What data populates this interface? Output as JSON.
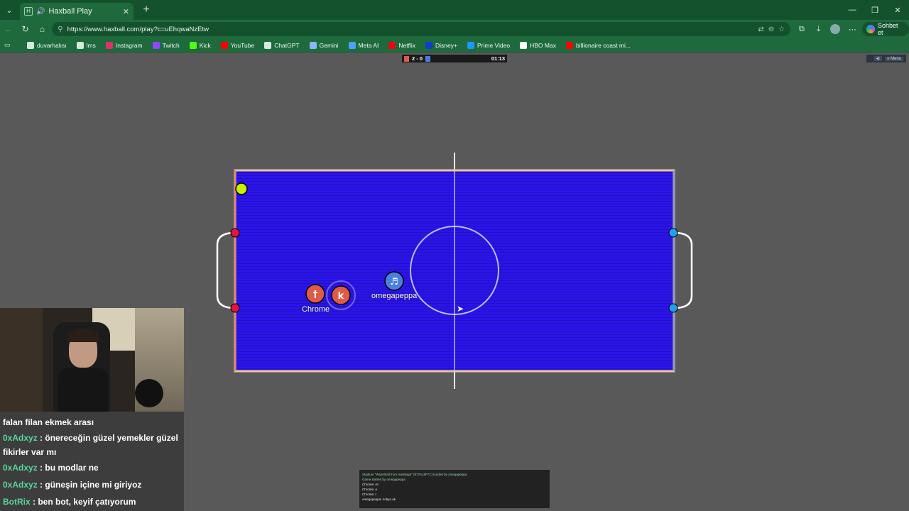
{
  "browser": {
    "tab_title": "Haxball Play",
    "url": "https://www.haxball.com/play?c=uEhqwaNzEtw",
    "copilot_label": "Sohbet et"
  },
  "bookmarks": [
    {
      "label": "duvarhalısı",
      "icon": "dot-icon",
      "color": "#d7e8dc"
    },
    {
      "label": "lms",
      "icon": "globe-icon",
      "color": "#d7e8dc"
    },
    {
      "label": "Instagram",
      "icon": "instagram-icon",
      "color": "#e1306c"
    },
    {
      "label": "Twitch",
      "icon": "twitch-icon",
      "color": "#9146ff"
    },
    {
      "label": "Kick",
      "icon": "kick-icon",
      "color": "#53fc18"
    },
    {
      "label": "YouTube",
      "icon": "youtube-icon",
      "color": "#ff0000"
    },
    {
      "label": "ChatGPT",
      "icon": "chatgpt-icon",
      "color": "#d7e8dc"
    },
    {
      "label": "Gemini",
      "icon": "gemini-icon",
      "color": "#8ab4f8"
    },
    {
      "label": "Meta AI",
      "icon": "meta-ai-icon",
      "color": "#4aa3ff"
    },
    {
      "label": "Netflix",
      "icon": "netflix-icon",
      "color": "#e50914"
    },
    {
      "label": "Disney+",
      "icon": "disney-icon",
      "color": "#113ccf"
    },
    {
      "label": "Prime Video",
      "icon": "prime-video-icon",
      "color": "#1a98ff"
    },
    {
      "label": "HBO Max",
      "icon": "hbo-max-icon",
      "color": "#ffffff"
    },
    {
      "label": "billionaire coast mi...",
      "icon": "youtube-icon",
      "color": "#ff0000"
    }
  ],
  "game": {
    "score": "2 - 0",
    "time": "01:13",
    "menu_label": "Menu",
    "red_color": "#e05a4a",
    "blue_color": "#4a7fe0",
    "field_color": "#2a14e8",
    "players": [
      {
        "name": "Chrome",
        "avatar": "†",
        "team": "red"
      },
      {
        "name": "",
        "avatar": "k",
        "team": "red"
      },
      {
        "name": "omegapeppa",
        "avatar": "♬",
        "team": "blue"
      }
    ]
  },
  "stream_chat": [
    {
      "user": "",
      "message": "falan filan ekmek arası"
    },
    {
      "user": "0xAdxyz",
      "message": ": önereceğin güzel yemekler güzel fikirler var mı"
    },
    {
      "user": "0xAdxyz",
      "message": ": bu modlar ne"
    },
    {
      "user": "0xAdxyz",
      "message": ": güneşin içine mi giriyoz"
    },
    {
      "user": "BotRix",
      "message": ": ben bot, keyif çatıyorum"
    }
  ],
  "game_chat": [
    {
      "text": "Stadium \"WaterBall from HaxMaps\" (872A18F7C) loaded by omegapeppa",
      "system": true
    },
    {
      "text": "Game started by omegapeppa",
      "system": true
    },
    {
      "text": "Chrome: ez",
      "system": false
    },
    {
      "text": "Chrome: e",
      "system": false
    },
    {
      "text": "Chrome: r",
      "system": false
    },
    {
      "text": "omegapeppa: nobyo ak",
      "system": false
    }
  ]
}
